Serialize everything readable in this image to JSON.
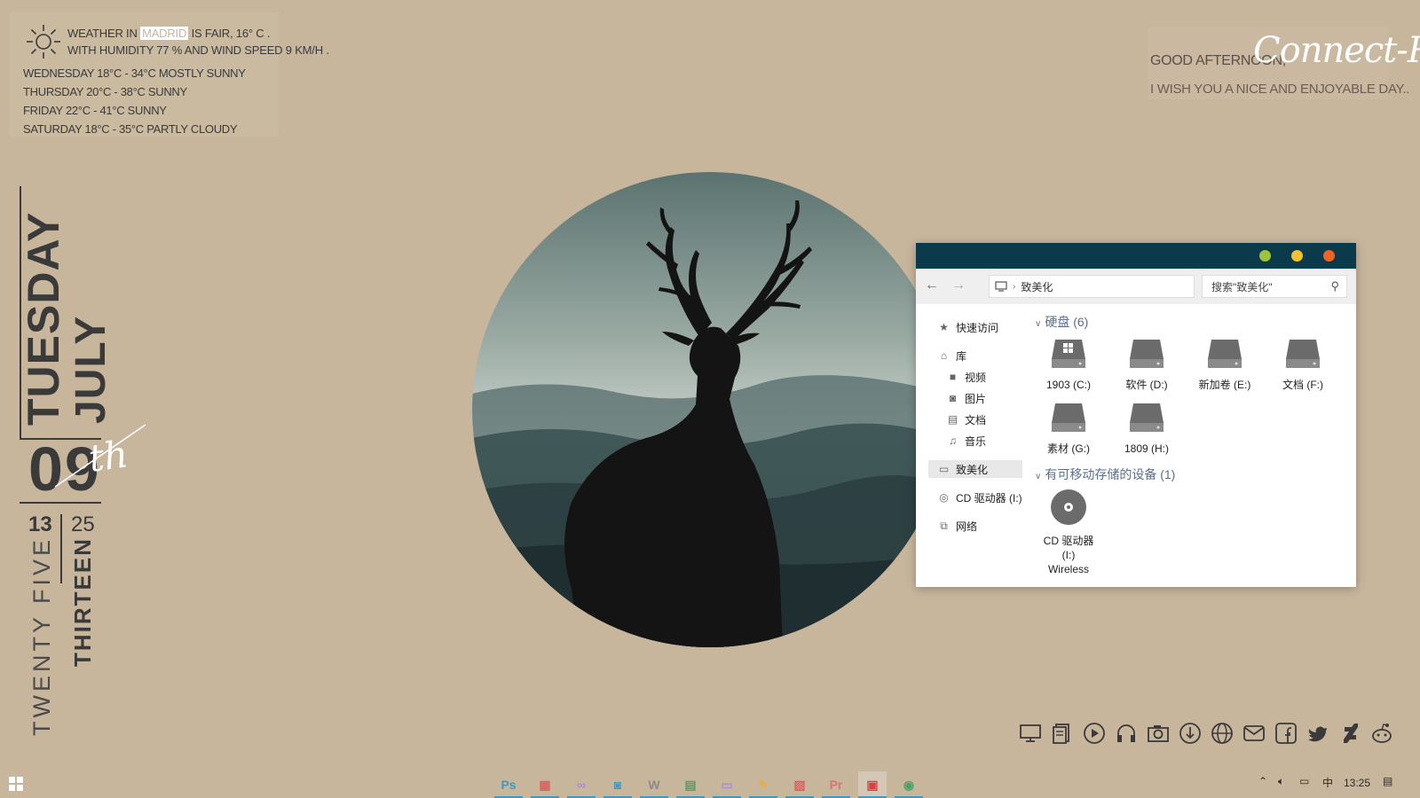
{
  "weather": {
    "icon": "sun-icon",
    "line1_prefix": "Weather in",
    "city": "Madrid",
    "line1_suffix": "is Fair, 16° C .",
    "line2": "With humidity 77 % and wind speed 9 km/h .",
    "forecast": [
      "Wednesday  18°C - 34°C  Mostly Sunny",
      "Thursday  20°C - 38°C  Sunny",
      "Friday  22°C - 41°C  Sunny",
      "Saturday  18°C - 35°C  Partly Cloudy"
    ]
  },
  "date": {
    "weekday": "TUESDAY",
    "month": "JULY",
    "day": "09",
    "ordinal": "th",
    "hour": "13",
    "minute": "25",
    "hour_word": "TWENTY FIVE",
    "minute_word": "THIRTEEN"
  },
  "greeting": {
    "line1": "Good afternoon,",
    "signature": "Connect-R .",
    "line2": "I wish you a nice and enjoyable day.."
  },
  "explorer": {
    "address": "致美化",
    "search_placeholder": "搜索\"致美化\"",
    "nav": {
      "quick_access": "快速访问",
      "library": "库",
      "videos": "视频",
      "pictures": "图片",
      "documents": "文档",
      "music": "音乐",
      "this_pc": "致美化",
      "cd_drive": "CD 驱动器 (I:)",
      "network": "网络"
    },
    "groups": {
      "hard_disks": "硬盘 (6)",
      "removable": "有可移动存储的设备 (1)"
    },
    "drives": [
      {
        "label": "1903 (C:)",
        "icon": "windows-drive-icon"
      },
      {
        "label": "软件 (D:)",
        "icon": "drive-icon"
      },
      {
        "label": "新加卷 (E:)",
        "icon": "drive-icon"
      },
      {
        "label": "文档 (F:)",
        "icon": "drive-icon"
      },
      {
        "label": "素材 (G:)",
        "icon": "drive-icon"
      },
      {
        "label": "1809 (H:)",
        "icon": "drive-icon"
      }
    ],
    "cd": {
      "line1": "CD 驱动器",
      "line2": "(I:)",
      "line3": "Wireless"
    },
    "colors": {
      "titlebar": "#0b3a4a",
      "min": "#9fc43a",
      "max": "#f2c12e",
      "close": "#f26322"
    }
  },
  "dock": [
    "monitor-icon",
    "documents-icon",
    "play-icon",
    "headphones-icon",
    "camera-icon",
    "download-icon",
    "globe-icon",
    "mail-icon",
    "facebook-icon",
    "twitter-icon",
    "deviantart-icon",
    "reddit-icon"
  ],
  "taskbar": {
    "apps": [
      {
        "name": "photoshop-icon",
        "label": "Ps",
        "color": "#3b9bc4"
      },
      {
        "name": "app-grid-icon",
        "label": "▦",
        "color": "#e06060"
      },
      {
        "name": "infinity-icon",
        "label": "∞",
        "color": "#b08bd0"
      },
      {
        "name": "camera-app-icon",
        "label": "◙",
        "color": "#3b9bc4"
      },
      {
        "name": "word-icon",
        "label": "W",
        "color": "#8a8a8a"
      },
      {
        "name": "notes-icon",
        "label": "▤",
        "color": "#4aa36a"
      },
      {
        "name": "keyboard-icon",
        "label": "▭",
        "color": "#b08bd0"
      },
      {
        "name": "pen-icon",
        "label": "✎",
        "color": "#e0b050"
      },
      {
        "name": "picture-icon",
        "label": "▨",
        "color": "#e06060"
      },
      {
        "name": "premiere-icon",
        "label": "Pr",
        "color": "#e07070"
      },
      {
        "name": "remote-desktop-icon",
        "label": "▣",
        "color": "#d94040"
      },
      {
        "name": "globe-app-icon",
        "label": "◉",
        "color": "#4aa36a"
      }
    ],
    "time": "13:25",
    "ime": "中"
  }
}
